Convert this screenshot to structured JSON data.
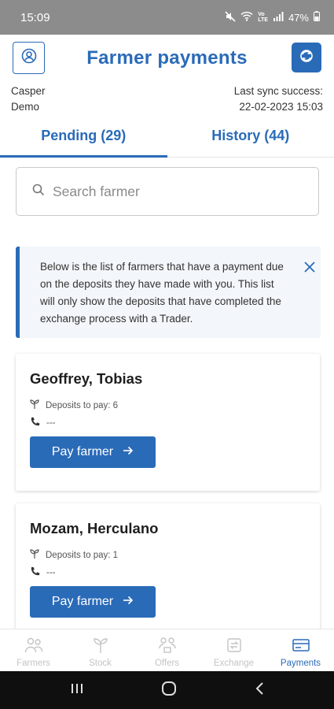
{
  "status_bar": {
    "time": "15:09",
    "battery": "47%"
  },
  "header": {
    "title": "Farmer payments",
    "profile_icon": "user-circle-icon",
    "sync_icon": "sync-icon"
  },
  "user": {
    "first_name": "Casper",
    "last_name": "Demo"
  },
  "sync": {
    "label": "Last sync success:",
    "datetime": "22-02-2023 15:03"
  },
  "tabs": [
    {
      "label": "Pending (29)",
      "active": true
    },
    {
      "label": "History (44)",
      "active": false
    }
  ],
  "search": {
    "placeholder": "Search farmer",
    "value": ""
  },
  "info": {
    "text": "Below is the list of farmers that have a payment due on the deposits they have made with you. This list will only show the deposits that have completed the exchange process with a Trader."
  },
  "farmers": [
    {
      "name": "Geoffrey, Tobias",
      "deposits": "Deposits to pay: 6",
      "phone": "---",
      "button": "Pay farmer"
    },
    {
      "name": "Mozam, Herculano",
      "deposits": "Deposits to pay: 1",
      "phone": "---",
      "button": "Pay farmer"
    }
  ],
  "bottom_nav": [
    {
      "label": "Farmers",
      "icon": "farmers-icon",
      "active": false
    },
    {
      "label": "Stock",
      "icon": "plant-icon",
      "active": false
    },
    {
      "label": "Offers",
      "icon": "offers-icon",
      "active": false
    },
    {
      "label": "Exchange",
      "icon": "exchange-icon",
      "active": false
    },
    {
      "label": "Payments",
      "icon": "payments-icon",
      "active": true
    }
  ],
  "colors": {
    "primary": "#2a6bb8",
    "status_bar": "#8c8c8c",
    "inactive": "#c4c4c4"
  }
}
